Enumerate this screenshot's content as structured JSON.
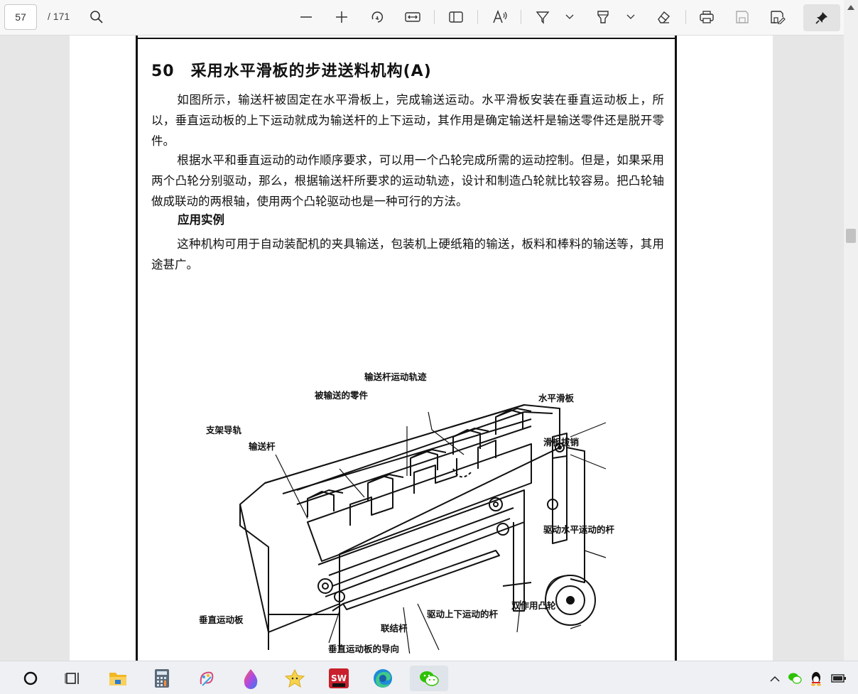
{
  "toolbar": {
    "page_current": "57",
    "page_total": "/ 171",
    "icons": [
      "search-icon",
      "zoom-out-icon",
      "zoom-in-icon",
      "rotate-icon",
      "fit-width-icon",
      "page-view-icon",
      "read-aloud-icon",
      "draw-icon",
      "highlight-icon",
      "eraser-icon",
      "print-icon",
      "save-icon",
      "save-as-icon",
      "pin-icon"
    ]
  },
  "document": {
    "heading": "50　采用水平滑板的步进送料机构(A)",
    "paragraphs": [
      "如图所示，输送杆被固定在水平滑板上，完成输送运动。水平滑板安装在垂直运动板上，所以，垂直运动板的上下运动就成为输送杆的上下运动，其作用是确定输送杆是输送零件还是脱开零件。",
      "根据水平和垂直运动的动作顺序要求，可以用一个凸轮完成所需的运动控制。但是，如果采用两个凸轮分别驱动，那么，根据输送杆所要求的运动轨迹，设计和制造凸轮就比较容易。把凸轮轴做成联动的两根轴，使用两个凸轮驱动也是一种可行的方法。"
    ],
    "subheading": "应用实例",
    "application": "这种机构可用于自动装配机的夹具输送，包装机上硬纸箱的输送，板料和棒料的输送等，其用途甚广。",
    "figure_labels": {
      "track": "输送杆运动轨迹",
      "parts": "被输送的零件",
      "h_slide": "水平滑板",
      "rail": "支架导轨",
      "bar": "输送杆",
      "pin": "滑板拔销",
      "h_rod": "驱动水平运动的杆",
      "cam": "双作用凸轮",
      "v_rod": "驱动上下运动的杆",
      "v_plate": "垂直运动板",
      "link": "联结杆",
      "guide": "垂直运动板的导向"
    }
  },
  "taskbar": {
    "apps": [
      "start-icon",
      "task-view-icon",
      "file-explorer-icon",
      "calculator-icon",
      "paint-icon",
      "color-drop-icon",
      "star-app-icon",
      "solidworks-icon",
      "edge-icon",
      "wechat-icon"
    ],
    "tray": [
      "chevron-up-icon",
      "wechat-tray-icon",
      "qq-icon",
      "battery-icon"
    ]
  }
}
